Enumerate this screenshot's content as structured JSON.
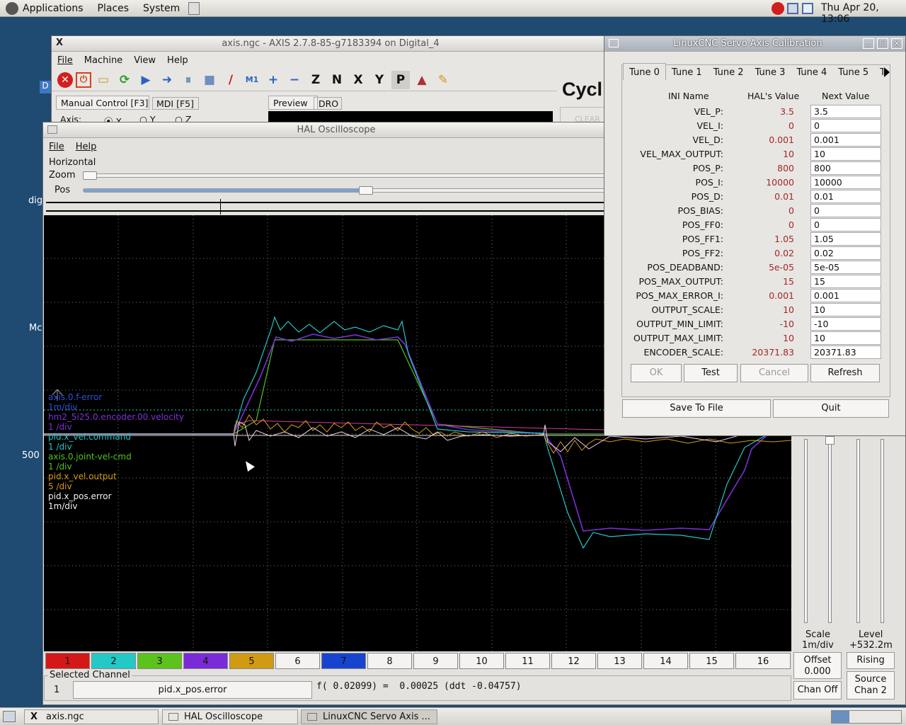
{
  "panel": {
    "menus": [
      "Applications",
      "Places",
      "System"
    ],
    "clock": "Thu Apr 20, 13:06"
  },
  "desktop": {
    "labels": [
      "dig",
      "Mc",
      "500"
    ]
  },
  "axis": {
    "title": "axis.ngc - AXIS 2.7.8-85-g7183394 on Digital_4",
    "menus": [
      "File",
      "Machine",
      "View",
      "Help"
    ],
    "tabs": {
      "manual": "Manual Control [F3]",
      "mdi": "MDI [F5]",
      "preview": "Preview",
      "dro": "DRO"
    },
    "axis_label": "Axis:",
    "axis_options": [
      "X",
      "Y",
      "Z"
    ],
    "cycle": "Cycl",
    "clear": "CLEAR"
  },
  "hal": {
    "title": "HAL Oscilloscope",
    "menus": [
      "File",
      "Help"
    ],
    "horizontal": "Horizontal",
    "zoom": "Zoom",
    "pos": "Pos",
    "legend": [
      {
        "name": "axis.0.f-error",
        "div": "1m/div",
        "color": "#2a52d8"
      },
      {
        "name": "hm2_5i25.0.encoder.00.velocity",
        "div": "1 /div",
        "color": "#7b2fd6"
      },
      {
        "name": "pid.x_vel.command",
        "div": "1 /div",
        "color": "#23c7c4"
      },
      {
        "name": "axis.0.joint-vel-cmd",
        "div": "1 /div",
        "color": "#55c21f"
      },
      {
        "name": "pid.x_vel.output",
        "div": "5 /div",
        "color": "#d49b14"
      },
      {
        "name": "pid.x_pos.error",
        "div": "1m/div",
        "color": "#f2f2f2"
      }
    ],
    "channels": [
      {
        "label": "1",
        "bg": "#d41818"
      },
      {
        "label": "2",
        "bg": "#22c9c6"
      },
      {
        "label": "3",
        "bg": "#5cc21c"
      },
      {
        "label": "4",
        "bg": "#7a2ad6"
      },
      {
        "label": "5",
        "bg": "#d09a12"
      },
      {
        "label": "6",
        "bg": "#f4f3f1"
      },
      {
        "label": "7",
        "bg": "#1744cf"
      },
      {
        "label": "8",
        "bg": "#f4f3f1"
      },
      {
        "label": "9",
        "bg": "#f4f3f1"
      },
      {
        "label": "10",
        "bg": "#f4f3f1"
      },
      {
        "label": "11",
        "bg": "#f4f3f1"
      },
      {
        "label": "12",
        "bg": "#f4f3f1"
      },
      {
        "label": "13",
        "bg": "#f4f3f1"
      },
      {
        "label": "14",
        "bg": "#f4f3f1"
      },
      {
        "label": "15",
        "bg": "#f4f3f1"
      },
      {
        "label": "16",
        "bg": "#f4f3f1"
      }
    ],
    "selected_channel": "Selected Channel",
    "sel_num": "1",
    "sel_name": "pid.x_pos.error",
    "readout": "f( 0.02099) =  0.00025 (ddt -0.04757)",
    "scale": "Scale",
    "scale_val": "1m/div",
    "offset": "Offset",
    "offset_val": "0.000",
    "chan_off": "Chan Off",
    "level": "Level",
    "level_val": "+532.2m",
    "rising": "Rising",
    "source": "Source",
    "source_val": "Chan  2"
  },
  "cal": {
    "title": "LinuxCNC Servo Axis Calibration",
    "tabs": [
      "Tune 0",
      "Tune 1",
      "Tune 2",
      "Tune 3",
      "Tune 4",
      "Tune 5",
      "Tu"
    ],
    "headers": {
      "ini": "INI Name",
      "hal": "HAL's Value",
      "next": "Next Value"
    },
    "rows": [
      {
        "name": "VEL_P:",
        "hal": "3.5",
        "next": "3.5"
      },
      {
        "name": "VEL_I:",
        "hal": "0",
        "next": "0"
      },
      {
        "name": "VEL_D:",
        "hal": "0.001",
        "next": "0.001"
      },
      {
        "name": "VEL_MAX_OUTPUT:",
        "hal": "10",
        "next": "10"
      },
      {
        "name": "POS_P:",
        "hal": "800",
        "next": "800"
      },
      {
        "name": "POS_I:",
        "hal": "10000",
        "next": "10000"
      },
      {
        "name": "POS_D:",
        "hal": "0.01",
        "next": "0.01"
      },
      {
        "name": "POS_BIAS:",
        "hal": "0",
        "next": "0"
      },
      {
        "name": "POS_FF0:",
        "hal": "0",
        "next": "0"
      },
      {
        "name": "POS_FF1:",
        "hal": "1.05",
        "next": "1.05"
      },
      {
        "name": "POS_FF2:",
        "hal": "0.02",
        "next": "0.02"
      },
      {
        "name": "POS_DEADBAND:",
        "hal": "5e-05",
        "next": "5e-05"
      },
      {
        "name": "POS_MAX_OUTPUT:",
        "hal": "15",
        "next": "15"
      },
      {
        "name": "POS_MAX_ERROR_I:",
        "hal": "0.001",
        "next": "0.001"
      },
      {
        "name": "OUTPUT_SCALE:",
        "hal": "10",
        "next": "10"
      },
      {
        "name": "OUTPUT_MIN_LIMIT:",
        "hal": "-10",
        "next": "-10"
      },
      {
        "name": "OUTPUT_MAX_LIMIT:",
        "hal": "10",
        "next": "10"
      },
      {
        "name": "ENCODER_SCALE:",
        "hal": "20371.83",
        "next": "20371.83"
      }
    ],
    "buttons": {
      "ok": "OK",
      "test": "Test",
      "cancel": "Cancel",
      "refresh": "Refresh",
      "save": "Save To File",
      "quit": "Quit"
    }
  },
  "taskbar": [
    "axis.ngc",
    "HAL Oscilloscope",
    "LinuxCNC Servo Axis ..."
  ]
}
